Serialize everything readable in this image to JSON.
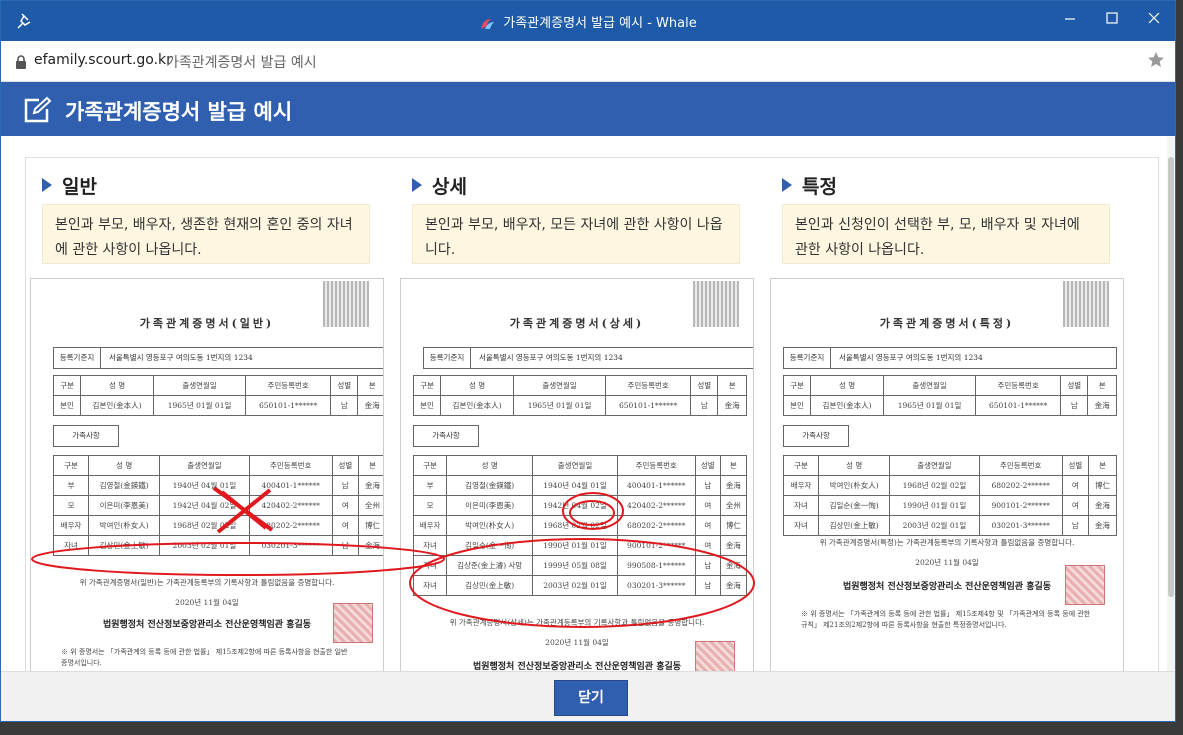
{
  "window": {
    "title": "가족관계증명서 발급 예시 - Whale"
  },
  "address_bar": {
    "host": "efamily.scourt.go.kr",
    "page_title": "가족관계증명서 발급 예시"
  },
  "header": {
    "title": "가족관계증명서 발급 예시"
  },
  "columns": [
    {
      "heading": "일반",
      "description": "본인과 부모, 배우자, 생존한 현재의 혼인 중의 자녀에 관한 사항이 나옵니다.",
      "doc_title": "가족관계증명서(일반)",
      "basis_label": "등록기준지",
      "basis_value": "서울특별시 영등포구 여의도동 1번지의 1234",
      "family_label": "가족사항",
      "self_rows": [
        [
          "본인",
          "김본인(金本人)",
          "1965년 01월 01일",
          "650101-1******",
          "남",
          "金海"
        ]
      ],
      "family_rows": [
        [
          "부",
          "김영철(金鍈鐵)",
          "1940년 04월 01일",
          "400401-1******",
          "남",
          "金海"
        ],
        [
          "모",
          "이은미(李恩美)",
          "1942년 04월 02일",
          "420402-2******",
          "여",
          "全州"
        ],
        [
          "배우자",
          "박여인(朴女人)",
          "1968년 02월 02일",
          "680202-2******",
          "여",
          "博仁"
        ],
        [
          "자녀",
          "김상민(金上敏)",
          "2003년 02월 01일",
          "030201-3******",
          "남",
          "金海"
        ]
      ],
      "note": "위 가족관계증명서(일반)는 가족관계등록부의 기록사항과 틀림없음을 증명합니다.",
      "date": "2020년 11월 04일",
      "sign": "법원행정처 전산정보중앙관리소 전산운영책임관 홍길동",
      "footnote": "※ 위 증명서는 「가족관계의 등록 등에 관한 법률」 제15조제2항에 따른 등록사항을 현출한 일반증명서입니다."
    },
    {
      "heading": "상세",
      "description": "본인과 부모, 배우자, 모든 자녀에 관한 사항이 나옵니다.",
      "doc_title": "가족관계증명서(상세)",
      "basis_label": "등록기준지",
      "basis_value": "서울특별시 영등포구 여의도동 1번지의 1234",
      "family_label": "가족사항",
      "self_rows": [
        [
          "본인",
          "김본인(金本人)",
          "1965년 01월 01일",
          "650101-1******",
          "남",
          "金海"
        ]
      ],
      "family_rows": [
        [
          "부",
          "김영철(金鍈鐵)",
          "1940년 04월 01일",
          "400401-1******",
          "남",
          "金海"
        ],
        [
          "모",
          "이은미(李恩美)",
          "1942년 04월 02일",
          "420402-2******",
          "여",
          "全州"
        ],
        [
          "배우자",
          "박여인(朴女人)",
          "1968년 02월 02일",
          "680202-2******",
          "여",
          "博仁"
        ],
        [
          "자녀",
          "김일순(金一恂)",
          "1990년 01월 01일",
          "900101-2******",
          "여",
          "金海"
        ],
        [
          "자녀",
          "김상준(金上濬) 사망",
          "1999년 05월 08일",
          "990508-1******",
          "남",
          "金海"
        ],
        [
          "자녀",
          "김상민(金上敏)",
          "2003년 02월 01일",
          "030201-3******",
          "남",
          "金海"
        ]
      ],
      "note": "위 가족관계증명서(상세)는 가족관계등록부의 기록사항과 틀림없음을 증명합니다.",
      "date": "2020년 11월 04일",
      "sign": "법원행정처 전산정보중앙관리소 전산운영책임관 홍길동",
      "footnote": ""
    },
    {
      "heading": "특정",
      "description": "본인과 신청인이 선택한 부, 모, 배우자 및 자녀에 관한 사항이 나옵니다.",
      "doc_title": "가족관계증명서(특정)",
      "basis_label": "등록기준지",
      "basis_value": "서울특별시 영등포구 여의도동 1번지의 1234",
      "family_label": "가족사항",
      "self_rows": [
        [
          "본인",
          "김본인(金本人)",
          "1965년 01월 01일",
          "650101-1******",
          "남",
          "金海"
        ]
      ],
      "family_rows": [
        [
          "배우자",
          "박여인(朴女人)",
          "1968년 02월 02일",
          "680202-2******",
          "여",
          "博仁"
        ],
        [
          "자녀",
          "김일순(金一恂)",
          "1990년 01월 01일",
          "900101-2******",
          "여",
          "金海"
        ],
        [
          "자녀",
          "김상민(金上敏)",
          "2003년 02월 01일",
          "030201-3******",
          "남",
          "金海"
        ]
      ],
      "note": "위 가족관계증명서(특정)는 가족관계등록부의 기록사항과 틀림없음을 증명합니다.",
      "date": "2020년 11월 04일",
      "sign": "법원행정처 전산정보중앙관리소 전산운영책임관 홍길동",
      "footnote": "※ 위 증명서는 「가족관계의 등록 등에 관한 법률」 제15조제4항 및 「가족관계의 등록 등에 관한 규칙」 제21조의2제2항에 따른 등록사항을 현출한 특정증명서입니다."
    }
  ],
  "table_header": [
    "구분",
    "성 명",
    "출생연월일",
    "주민등록번호",
    "성별",
    "본"
  ],
  "close_button": "닫기",
  "colors": {
    "brand": "#2f5fae",
    "titlebar": "#1e5aa8",
    "desc_bg": "#fdf7e1",
    "annotation": "#e0191e"
  }
}
